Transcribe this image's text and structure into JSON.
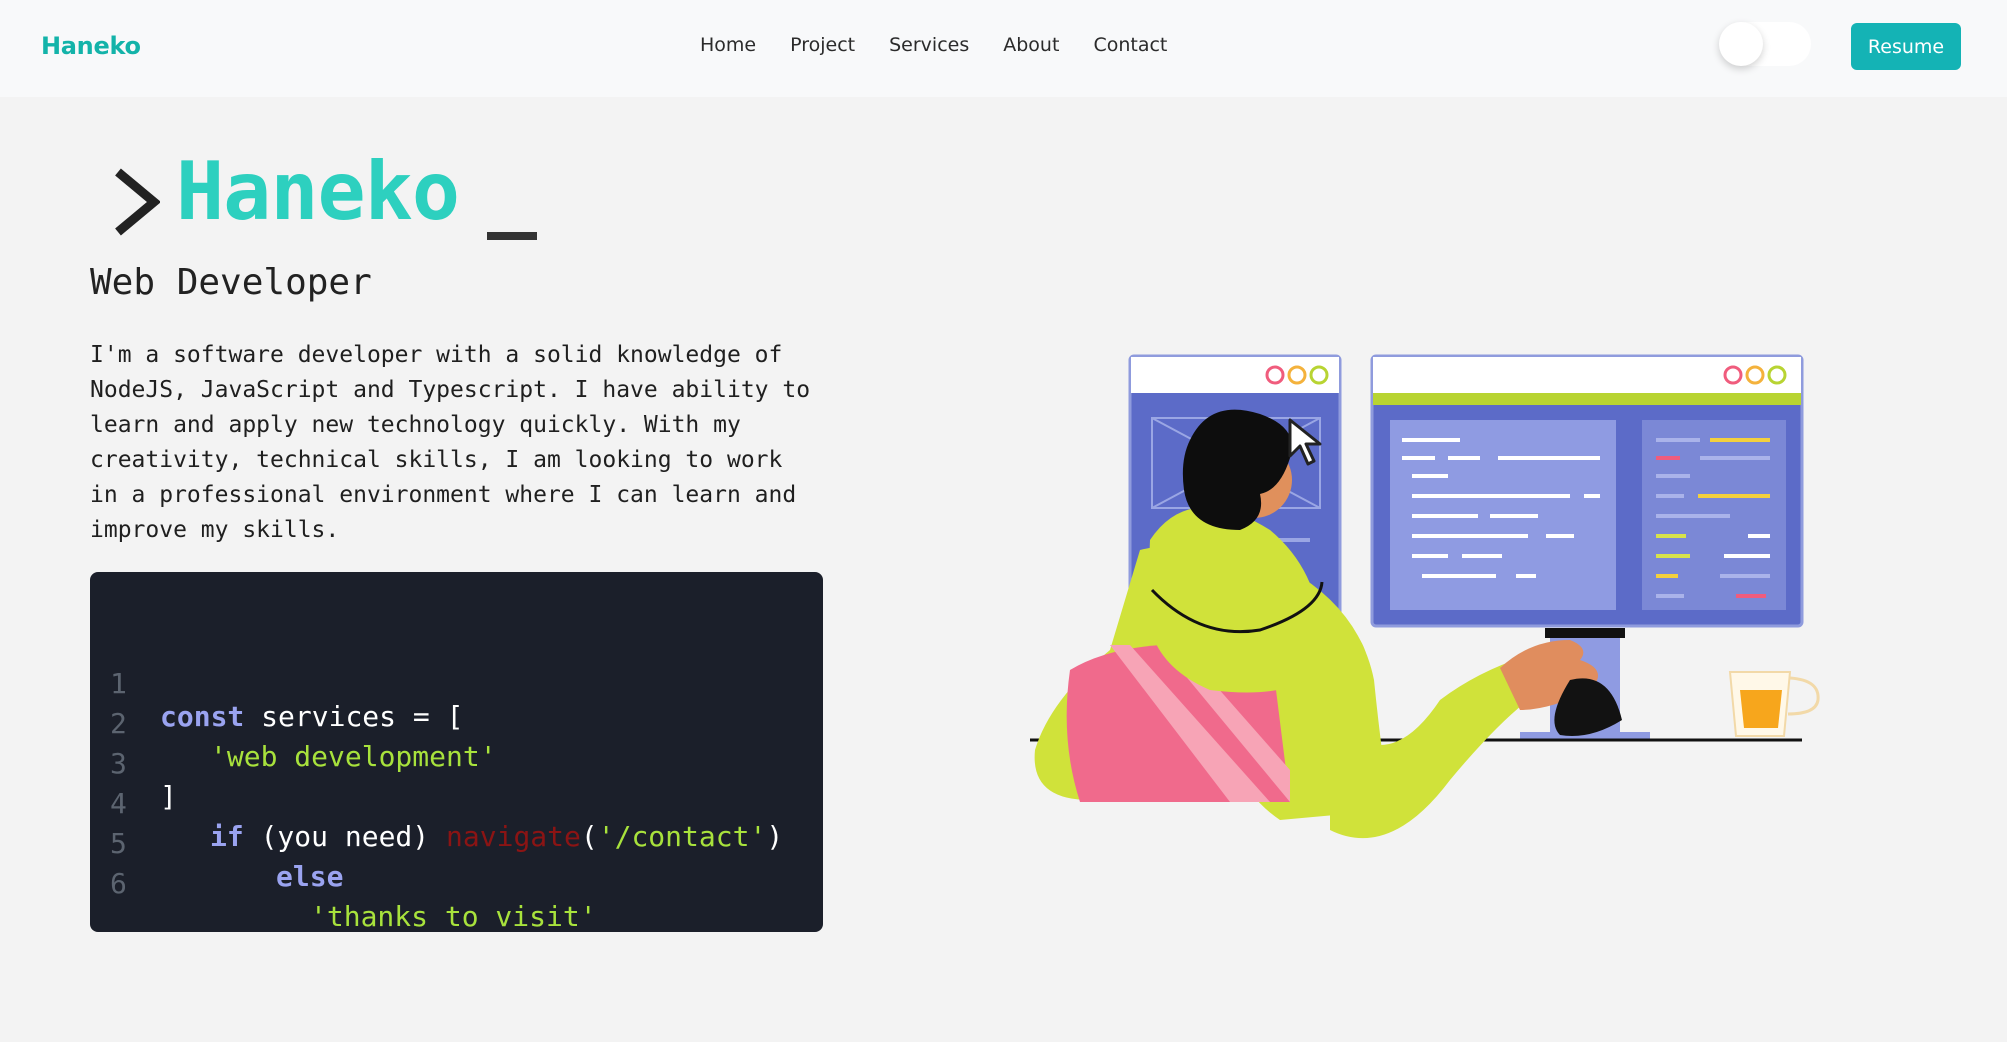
{
  "nav": {
    "brand": "Haneko",
    "links": [
      "Home",
      "Project",
      "Services",
      "About",
      "Contact"
    ],
    "resume_label": "Resume"
  },
  "hero": {
    "name": "Haneko",
    "subtitle": "Web Developer",
    "bio_lines": [
      "I'm a software developer with a solid knowledge of",
      "NodeJS, JavaScript and Typescript. I have ability to",
      "learn and apply new technology quickly. With my",
      "creativity, technical skills, I am looking to work",
      "in a professional environment where I can learn and",
      "improve my skills."
    ]
  },
  "code": {
    "line_numbers": [
      "1",
      "2",
      "3",
      "4",
      "5",
      "6"
    ],
    "lines": [
      [
        {
          "t": "const",
          "c": "kw"
        },
        {
          "t": " services = [",
          "c": "pl"
        }
      ],
      [
        {
          "t": "'web development'",
          "c": "str"
        }
      ],
      [
        {
          "t": "]",
          "c": "pl"
        }
      ],
      [
        {
          "t": "if",
          "c": "kw"
        },
        {
          "t": " (you need) ",
          "c": "pl"
        },
        {
          "t": "navigate",
          "c": "fn"
        },
        {
          "t": "(",
          "c": "pl"
        },
        {
          "t": "'/contact'",
          "c": "str"
        },
        {
          "t": ")",
          "c": "pl"
        }
      ],
      [
        {
          "t": "else",
          "c": "kw"
        }
      ],
      [
        {
          "t": "'thanks to visit'",
          "c": "str"
        }
      ]
    ]
  },
  "colors": {
    "accent": "#13b3a9",
    "hero_name": "#2dd0bf",
    "resume_button": "#14b3b5",
    "code_background": "#1b1f2a"
  },
  "icons": {
    "prompt": "chevron-right-icon",
    "theme_toggle": "toggle-switch-icon",
    "illustration": "developer-at-monitors-illustration"
  }
}
